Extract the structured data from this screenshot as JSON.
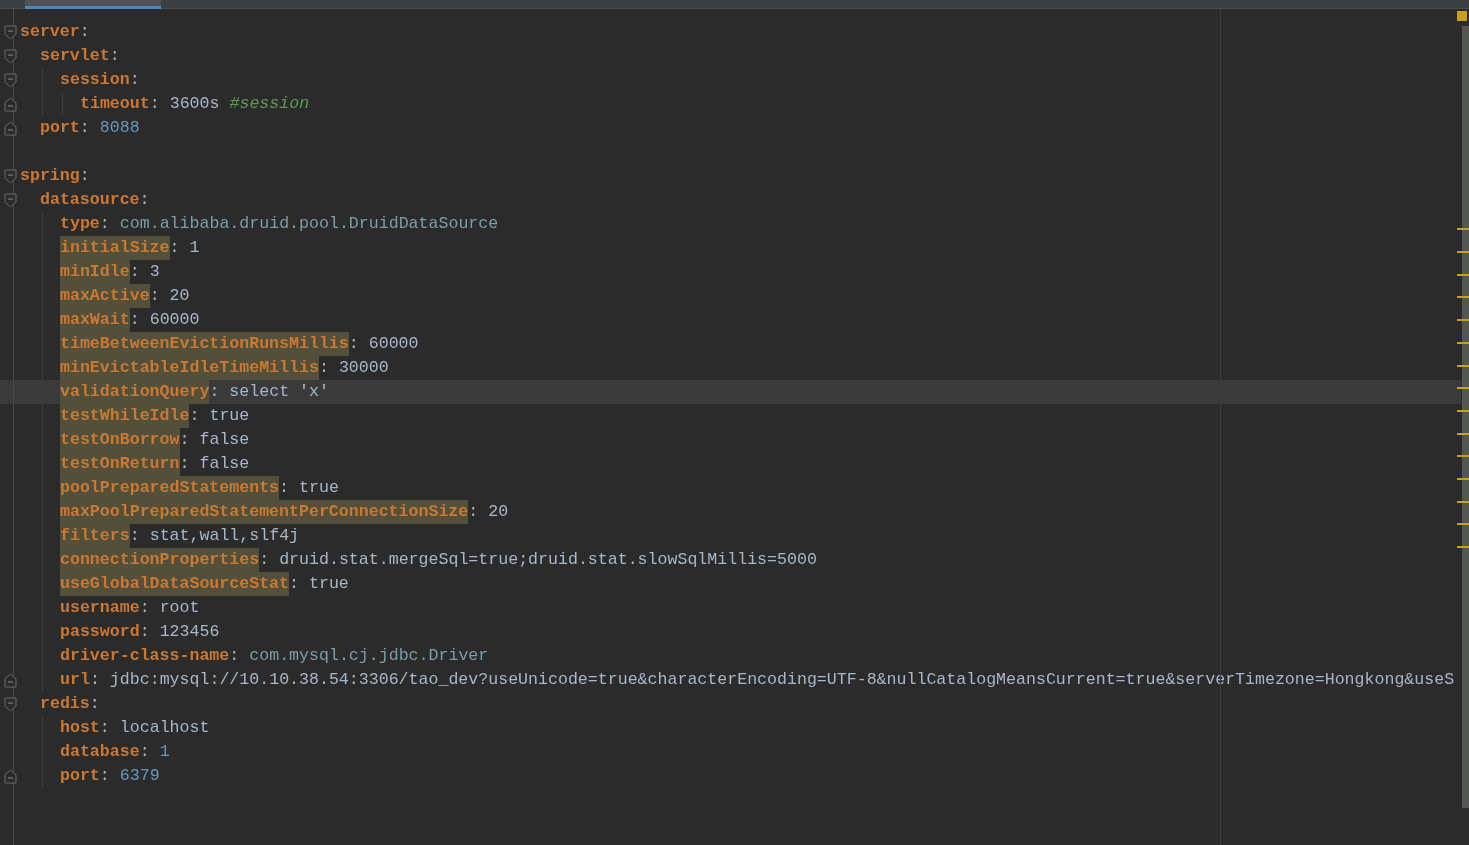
{
  "tab": {
    "selected": true
  },
  "status": {
    "kind": "warning"
  },
  "sections": [
    {
      "key": "server",
      "colon": ":",
      "fold_start": true,
      "fold_end": false,
      "highlighted": false,
      "current": false,
      "children": [
        {
          "key": "servlet",
          "colon": ":",
          "fold_start": true,
          "fold_end": false,
          "highlighted": false,
          "current": false,
          "children": [
            {
              "key": "session",
              "colon": ":",
              "fold_start": true,
              "fold_end": false,
              "highlighted": false,
              "current": false,
              "children": [
                {
                  "key": "timeout",
                  "colon": ":",
                  "value": {
                    "text": "3600s",
                    "kind": "plain"
                  },
                  "comment": "#session",
                  "fold_start": false,
                  "fold_end": true,
                  "highlighted": false,
                  "current": false
                }
              ]
            }
          ]
        },
        {
          "key": "port",
          "colon": ":",
          "value": {
            "text": "8088",
            "kind": "number"
          },
          "fold_start": false,
          "fold_end": true,
          "highlighted": false,
          "current": false
        }
      ]
    },
    {
      "key": "spring",
      "colon": ":",
      "fold_start": true,
      "fold_end": false,
      "highlighted": false,
      "current": false,
      "children": [
        {
          "key": "datasource",
          "colon": ":",
          "fold_start": true,
          "fold_end": false,
          "highlighted": false,
          "current": false,
          "children": [
            {
              "key": "type",
              "colon": ":",
              "value": {
                "text": "com.alibaba.druid.pool.DruidDataSource",
                "kind": "class"
              },
              "fold_start": false,
              "fold_end": false,
              "highlighted": false,
              "current": false
            },
            {
              "key": "initialSize",
              "colon": ":",
              "value": {
                "text": "1",
                "kind": "plain"
              },
              "fold_start": false,
              "fold_end": false,
              "highlighted": true,
              "current": false
            },
            {
              "key": "minIdle",
              "colon": ":",
              "value": {
                "text": "3",
                "kind": "plain"
              },
              "fold_start": false,
              "fold_end": false,
              "highlighted": true,
              "current": false
            },
            {
              "key": "maxActive",
              "colon": ":",
              "value": {
                "text": "20",
                "kind": "plain"
              },
              "fold_start": false,
              "fold_end": false,
              "highlighted": true,
              "current": false
            },
            {
              "key": "maxWait",
              "colon": ":",
              "value": {
                "text": "60000",
                "kind": "plain"
              },
              "fold_start": false,
              "fold_end": false,
              "highlighted": true,
              "current": false
            },
            {
              "key": "timeBetweenEvictionRunsMillis",
              "colon": ":",
              "value": {
                "text": "60000",
                "kind": "plain"
              },
              "fold_start": false,
              "fold_end": false,
              "highlighted": true,
              "current": false
            },
            {
              "key": "minEvictableIdleTimeMillis",
              "colon": ":",
              "value": {
                "text": "30000",
                "kind": "plain"
              },
              "fold_start": false,
              "fold_end": false,
              "highlighted": true,
              "current": false
            },
            {
              "key": "validationQuery",
              "colon": ":",
              "value": {
                "text": "select 'x'",
                "kind": "plain"
              },
              "fold_start": false,
              "fold_end": false,
              "highlighted": true,
              "current": true
            },
            {
              "key": "testWhileIdle",
              "colon": ":",
              "value": {
                "text": "true",
                "kind": "plain"
              },
              "fold_start": false,
              "fold_end": false,
              "highlighted": true,
              "current": false
            },
            {
              "key": "testOnBorrow",
              "colon": ":",
              "value": {
                "text": "false",
                "kind": "plain"
              },
              "fold_start": false,
              "fold_end": false,
              "highlighted": true,
              "current": false
            },
            {
              "key": "testOnReturn",
              "colon": ":",
              "value": {
                "text": "false",
                "kind": "plain"
              },
              "fold_start": false,
              "fold_end": false,
              "highlighted": true,
              "current": false
            },
            {
              "key": "poolPreparedStatements",
              "colon": ":",
              "value": {
                "text": "true",
                "kind": "plain"
              },
              "fold_start": false,
              "fold_end": false,
              "highlighted": true,
              "current": false
            },
            {
              "key": "maxPoolPreparedStatementPerConnectionSize",
              "colon": ":",
              "value": {
                "text": "20",
                "kind": "plain"
              },
              "fold_start": false,
              "fold_end": false,
              "highlighted": true,
              "current": false
            },
            {
              "key": "filters",
              "colon": ":",
              "value": {
                "text": "stat,wall,slf4j",
                "kind": "plain"
              },
              "fold_start": false,
              "fold_end": false,
              "highlighted": true,
              "current": false
            },
            {
              "key": "connectionProperties",
              "colon": ":",
              "value": {
                "text": "druid.stat.mergeSql=true;druid.stat.slowSqlMillis=5000",
                "kind": "plain"
              },
              "fold_start": false,
              "fold_end": false,
              "highlighted": true,
              "current": false
            },
            {
              "key": "useGlobalDataSourceStat",
              "colon": ":",
              "value": {
                "text": "true",
                "kind": "plain"
              },
              "fold_start": false,
              "fold_end": false,
              "highlighted": true,
              "current": false
            },
            {
              "key": "username",
              "colon": ":",
              "value": {
                "text": "root",
                "kind": "plain"
              },
              "fold_start": false,
              "fold_end": false,
              "highlighted": false,
              "current": false
            },
            {
              "key": "password",
              "colon": ":",
              "value": {
                "text": "123456",
                "kind": "plain"
              },
              "fold_start": false,
              "fold_end": false,
              "highlighted": false,
              "current": false
            },
            {
              "key": "driver-class-name",
              "colon": ":",
              "value": {
                "text": "com.mysql.cj.jdbc.Driver",
                "kind": "class"
              },
              "fold_start": false,
              "fold_end": false,
              "highlighted": false,
              "current": false
            },
            {
              "key": "url",
              "colon": ":",
              "value": {
                "text": "jdbc:mysql://10.10.38.54:3306/tao_dev?useUnicode=true&characterEncoding=UTF-8&nullCatalogMeansCurrent=true&serverTimezone=Hongkong&useS",
                "kind": "plain"
              },
              "fold_start": false,
              "fold_end": true,
              "highlighted": false,
              "current": false
            }
          ]
        },
        {
          "key": "redis",
          "colon": ":",
          "fold_start": true,
          "fold_end": false,
          "highlighted": false,
          "current": false,
          "children": [
            {
              "key": "host",
              "colon": ":",
              "value": {
                "text": "localhost",
                "kind": "plain"
              },
              "fold_start": false,
              "fold_end": false,
              "highlighted": false,
              "current": false
            },
            {
              "key": "database",
              "colon": ":",
              "value": {
                "text": "1",
                "kind": "number"
              },
              "fold_start": false,
              "fold_end": false,
              "highlighted": false,
              "current": false
            },
            {
              "key": "port",
              "colon": ":",
              "value": {
                "text": "6379",
                "kind": "number"
              },
              "fold_start": false,
              "fold_end": true,
              "highlighted": false,
              "current": false
            }
          ]
        }
      ]
    }
  ]
}
